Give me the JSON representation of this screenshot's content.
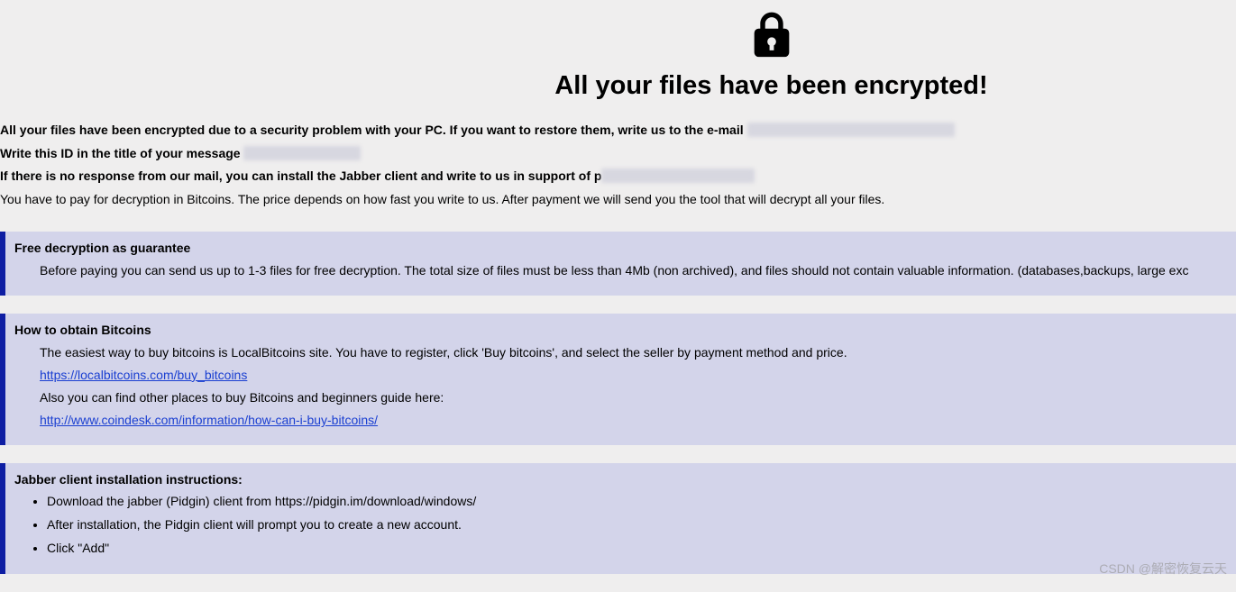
{
  "header": {
    "title": "All your files have been encrypted!"
  },
  "intro": {
    "line1_prefix": "All your files have been encrypted due to a security problem with your PC. If you want to restore them, write us to the e-mail ",
    "line2_prefix": "Write this ID in the title of your message ",
    "line3_prefix": "If there is no response from our mail, you can install the Jabber client and write to us in support of ",
    "line3_visible": "p",
    "line4": "You have to pay for decryption in Bitcoins. The price depends on how fast you write to us. After payment we will send you the tool that will decrypt all your files."
  },
  "panel_free": {
    "title": "Free decryption as guarantee",
    "body": "Before paying you can send us up to 1-3 files for free decryption. The total size of files must be less than 4Mb (non archived), and files should not contain valuable information. (databases,backups, large exc"
  },
  "panel_bitcoin": {
    "title": "How to obtain Bitcoins",
    "line1": "The easiest way to buy bitcoins is LocalBitcoins site. You have to register, click 'Buy bitcoins', and select the seller by payment method and price.",
    "link1": "https://localbitcoins.com/buy_bitcoins",
    "line2": "Also you can find other places to buy Bitcoins and beginners guide here:",
    "link2": "http://www.coindesk.com/information/how-can-i-buy-bitcoins/"
  },
  "panel_jabber": {
    "title": "Jabber client installation instructions:",
    "steps": [
      "Download the jabber (Pidgin) client from https://pidgin.im/download/windows/",
      "After installation, the Pidgin client will prompt you to create a new account.",
      "Click \"Add\""
    ]
  },
  "watermark": "CSDN @解密恢复云天"
}
